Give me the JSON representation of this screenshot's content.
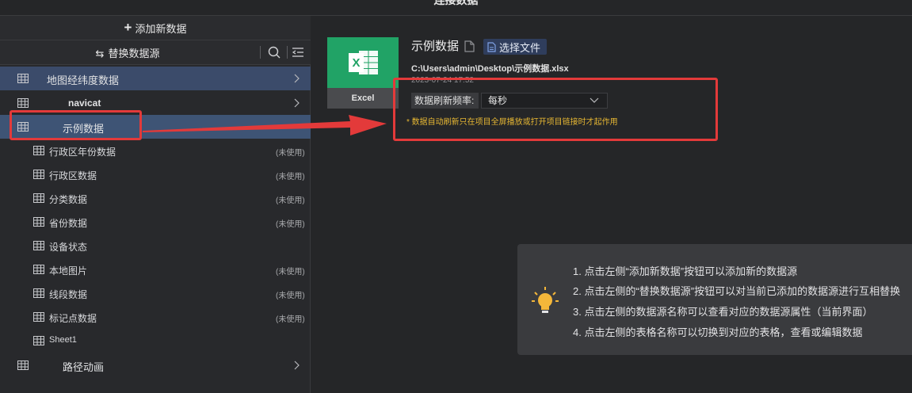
{
  "header": {
    "title": "连接数据"
  },
  "sidebar": {
    "add_label": "添加新数据",
    "replace_label": "替换数据源",
    "sources": [
      {
        "label": "地图经纬度数据"
      },
      {
        "label": "navicat"
      },
      {
        "label": "示例数据"
      },
      {
        "label": "路径动画"
      }
    ],
    "tables": [
      {
        "label": "行政区年份数据",
        "status": "(未使用)"
      },
      {
        "label": "行政区数据",
        "status": "(未使用)"
      },
      {
        "label": "分类数据",
        "status": "(未使用)"
      },
      {
        "label": "省份数据",
        "status": "(未使用)"
      },
      {
        "label": "设备状态",
        "status": ""
      },
      {
        "label": "本地图片",
        "status": "(未使用)"
      },
      {
        "label": "线段数据",
        "status": "(未使用)"
      },
      {
        "label": "标记点数据",
        "status": "(未使用)"
      },
      {
        "label": "Sheet1",
        "status": ""
      }
    ]
  },
  "detail": {
    "type_label": "Excel",
    "name": "示例数据",
    "choose_file_label": "选择文件",
    "file_path": "C:\\Users\\admin\\Desktop\\示例数据.xlsx",
    "updated": "2023-07-24 17:52",
    "refresh_label": "数据刷新频率:",
    "refresh_value": "每秒",
    "note": "* 数据自动刷新只在项目全屏播放或打开项目链接时才起作用"
  },
  "tips": [
    "1. 点击左侧“添加新数据”按钮可以添加新的数据源",
    "2. 点击左侧的“替换数据源”按钮可以对当前已添加的数据源进行互相替换",
    "3. 点击左侧的数据源名称可以查看对应的数据源属性（当前界面）",
    "4. 点击左侧的表格名称可以切换到对应的表格，查看或编辑数据"
  ],
  "colors": {
    "accent": "#3e5475",
    "excel_green": "#21a366",
    "annotation_red": "#e33a3a",
    "note_yellow": "#e6b733"
  }
}
